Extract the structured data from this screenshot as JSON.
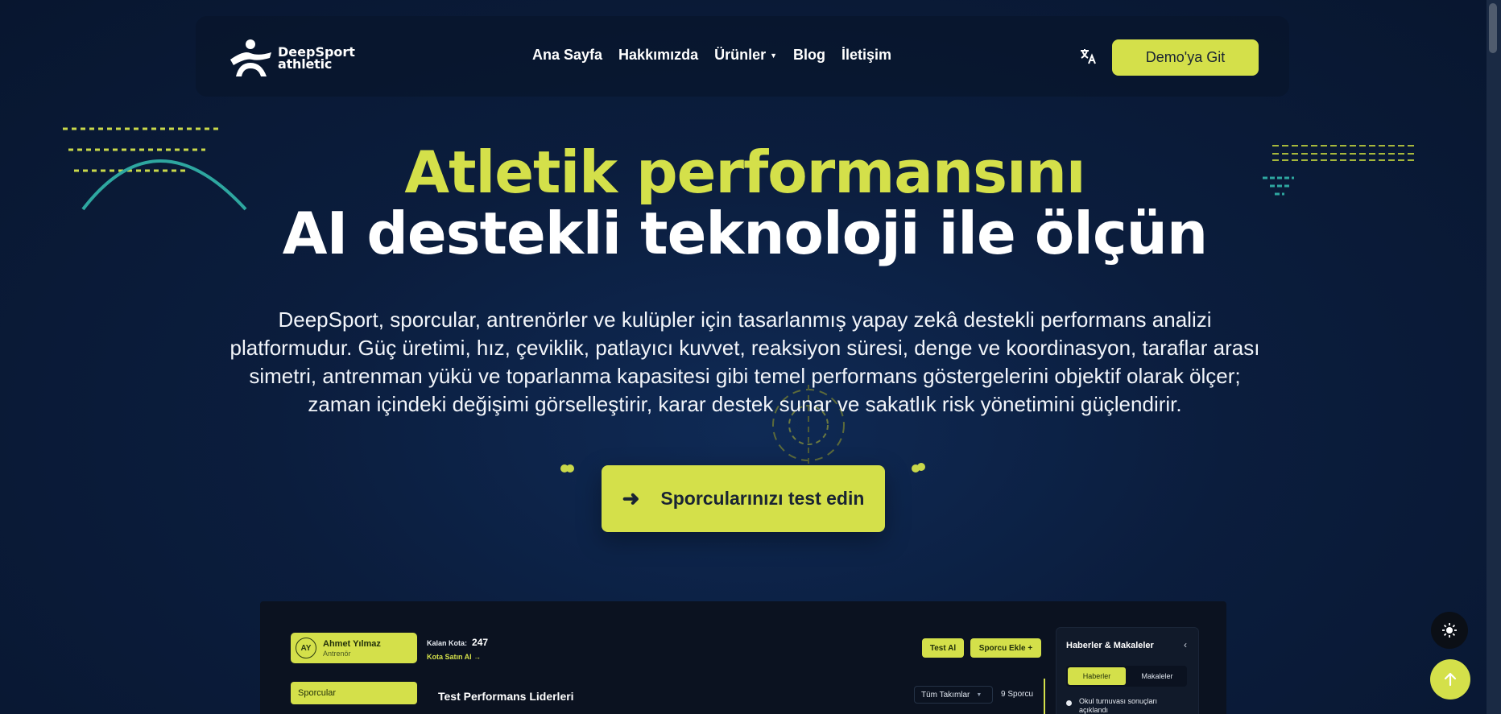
{
  "nav": {
    "logo_line1": "DeepSport",
    "logo_line2": "athletic",
    "links": [
      "Ana Sayfa",
      "Hakkımızda",
      "Ürünler",
      "Blog",
      "İletişim"
    ],
    "demo_label": "Demo'ya Git"
  },
  "hero": {
    "title_line1": "Atletik performansını",
    "title_line2": "AI destekli teknoloji ile ölçün",
    "description": "DeepSport, sporcular, antrenörler ve kulüpler için tasarlanmış yapay zekâ destekli performans analizi platformudur. Güç üretimi, hız, çeviklik, patlayıcı kuvvet, reaksiyon süresi, denge ve koordinasyon, taraflar arası simetri, antrenman yükü ve toparlanma kapasitesi gibi temel performans göstergelerini objektif olarak ölçer; zaman içindeki değişimi görselleştirir, karar destek sunar ve sakatlık risk yönetimini güçlendirir.",
    "cta_label": "Sporcularınızı test edin"
  },
  "dashboard": {
    "user_initials": "AY",
    "user_name": "Ahmet Yılmaz",
    "user_role": "Antrenör",
    "quota_label": "Kalan Kota:",
    "quota_value": "247",
    "quota_link": "Kota Satın Al →",
    "test_button": "Test Al",
    "add_button": "Sporcu Ekle +",
    "sidebar_item": "Sporcular",
    "leaders_title": "Test Performans Liderleri",
    "team_select": "Tüm Takımlar",
    "athlete_count": "9 Sporcu",
    "news_title": "Haberler & Makaleler",
    "news_tab_active": "Haberler",
    "news_tab": "Makaleler",
    "news_item": "Okul turnuvası sonuçları açıklandı"
  },
  "colors": {
    "accent": "#d4e04a",
    "background": "#0b1d3d",
    "teal": "#2ea7a0"
  }
}
